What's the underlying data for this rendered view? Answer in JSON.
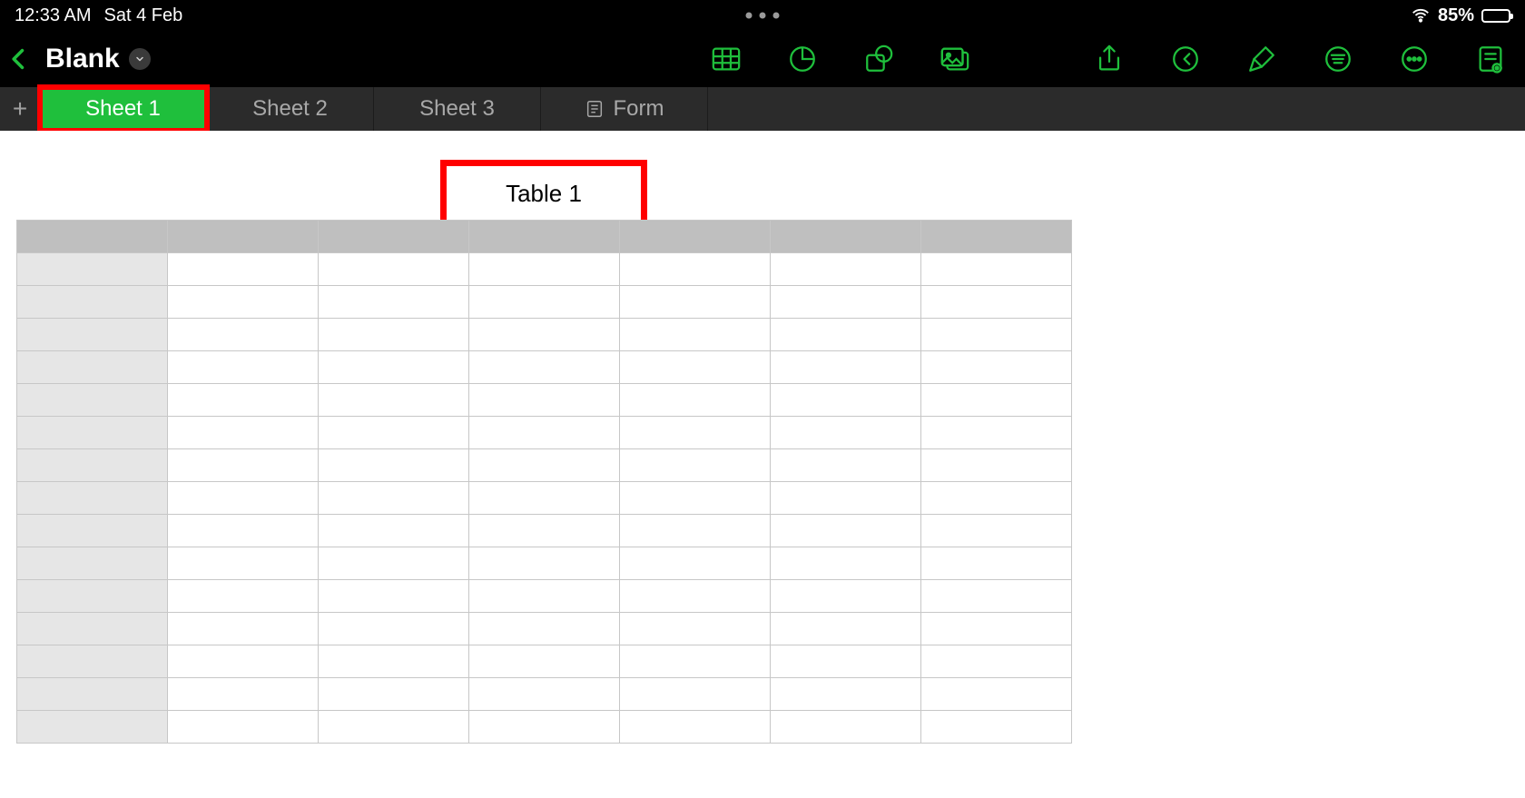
{
  "status_bar": {
    "time": "12:33 AM",
    "date": "Sat 4 Feb",
    "battery_percent": "85%"
  },
  "header": {
    "document_title": "Blank"
  },
  "toolbar": {
    "left_group": [
      {
        "name": "table-icon"
      },
      {
        "name": "chart-pie-icon"
      },
      {
        "name": "shape-icon"
      },
      {
        "name": "media-image-icon"
      }
    ],
    "right_group": [
      {
        "name": "share-icon"
      },
      {
        "name": "undo-icon"
      },
      {
        "name": "paintbrush-icon"
      },
      {
        "name": "organize-icon"
      },
      {
        "name": "more-circle-icon"
      },
      {
        "name": "collaborate-note-icon"
      }
    ]
  },
  "sheet_bar": {
    "tabs": [
      {
        "label": "Sheet 1",
        "active": true,
        "highlighted": true
      },
      {
        "label": "Sheet 2",
        "active": false,
        "highlighted": false
      },
      {
        "label": "Sheet 3",
        "active": false,
        "highlighted": false
      },
      {
        "label": "Form",
        "active": false,
        "highlighted": false,
        "icon": "form-icon"
      }
    ]
  },
  "canvas": {
    "table_title": "Table 1",
    "table_title_highlighted": true,
    "columns": 7,
    "rows": 15
  },
  "colors": {
    "accent_green": "#1fbf3c",
    "highlight_red": "#ff0000"
  }
}
